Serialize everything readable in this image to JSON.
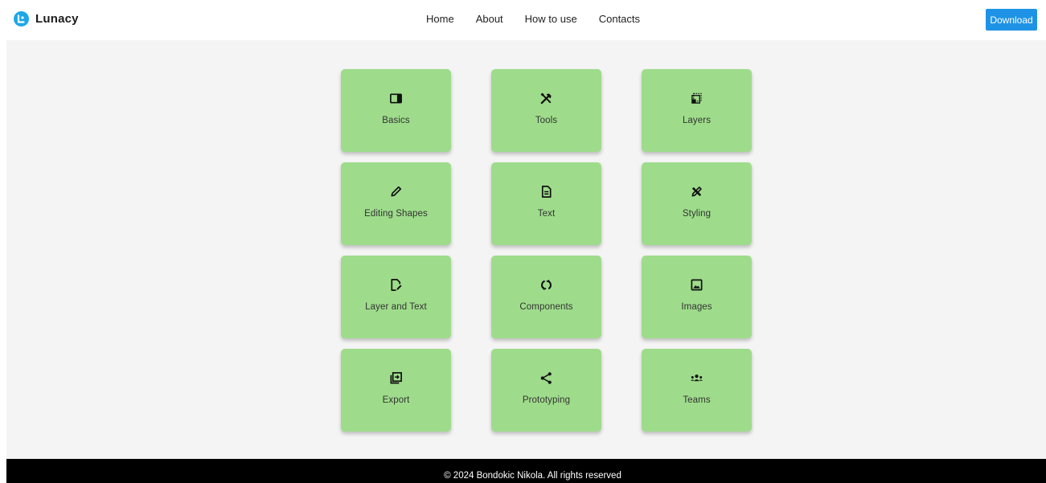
{
  "header": {
    "brand": "Lunacy",
    "nav": [
      "Home",
      "About",
      "How to use",
      "Contacts"
    ],
    "download_label": "Download"
  },
  "cards": [
    {
      "label": "Basics",
      "icon": "sidebar-panel-icon"
    },
    {
      "label": "Tools",
      "icon": "tools-icon"
    },
    {
      "label": "Layers",
      "icon": "layers-selection-icon"
    },
    {
      "label": "Editing Shapes",
      "icon": "pencil-icon"
    },
    {
      "label": "Text",
      "icon": "document-text-icon"
    },
    {
      "label": "Styling",
      "icon": "pencil-ruler-icon"
    },
    {
      "label": "Layer and Text",
      "icon": "file-edit-icon"
    },
    {
      "label": "Components",
      "icon": "components-icon"
    },
    {
      "label": "Images",
      "icon": "image-icon"
    },
    {
      "label": "Export",
      "icon": "export-icon"
    },
    {
      "label": "Prototyping",
      "icon": "share-icon"
    },
    {
      "label": "Teams",
      "icon": "users-icon"
    }
  ],
  "footer": {
    "text": "© 2024 Bondokic Nikola. All rights reserved"
  },
  "colors": {
    "brand": "#1ea7e8",
    "download_button": "#1e93e6",
    "card": "#9edc8b",
    "main_background": "#f4f4f4",
    "footer": "#000000"
  }
}
